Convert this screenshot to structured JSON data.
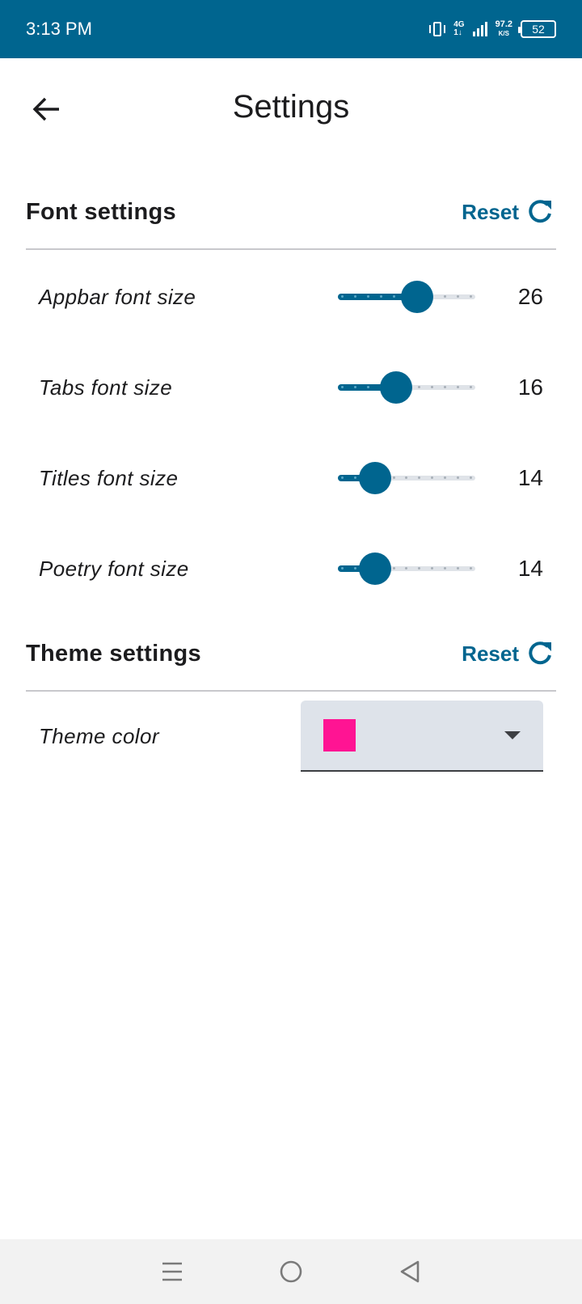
{
  "status_bar": {
    "time": "3:13 PM",
    "network_type": "4G",
    "network_sub": "1↓",
    "speed_value": "97.2",
    "speed_unit": "K/S",
    "battery": "52"
  },
  "app_bar": {
    "title": "Settings",
    "back_icon": "arrow-back-icon"
  },
  "colors": {
    "primary": "#00658f",
    "status_bar_bg": "#00658f",
    "theme_swatch": "#ff1493",
    "select_bg": "#dee3ea"
  },
  "font_settings": {
    "title": "Font settings",
    "reset_label": "Reset",
    "reset_icon": "refresh-icon",
    "rows": [
      {
        "label": "Appbar font size",
        "value": "26",
        "level": 0.6
      },
      {
        "label": "Tabs font size",
        "value": "16",
        "level": 0.4
      },
      {
        "label": "Titles font size",
        "value": "14",
        "level": 0.2
      },
      {
        "label": "Poetry font size",
        "value": "14",
        "level": 0.2
      }
    ]
  },
  "theme_settings": {
    "title": "Theme settings",
    "reset_label": "Reset",
    "reset_icon": "refresh-icon",
    "theme_color_label": "Theme color",
    "selected_color": "#ff1493",
    "dropdown_icon": "caret-down-icon"
  },
  "nav_bar": {
    "recents_icon": "menu-icon",
    "home_icon": "circle-home-icon",
    "back_icon": "triangle-back-icon"
  }
}
